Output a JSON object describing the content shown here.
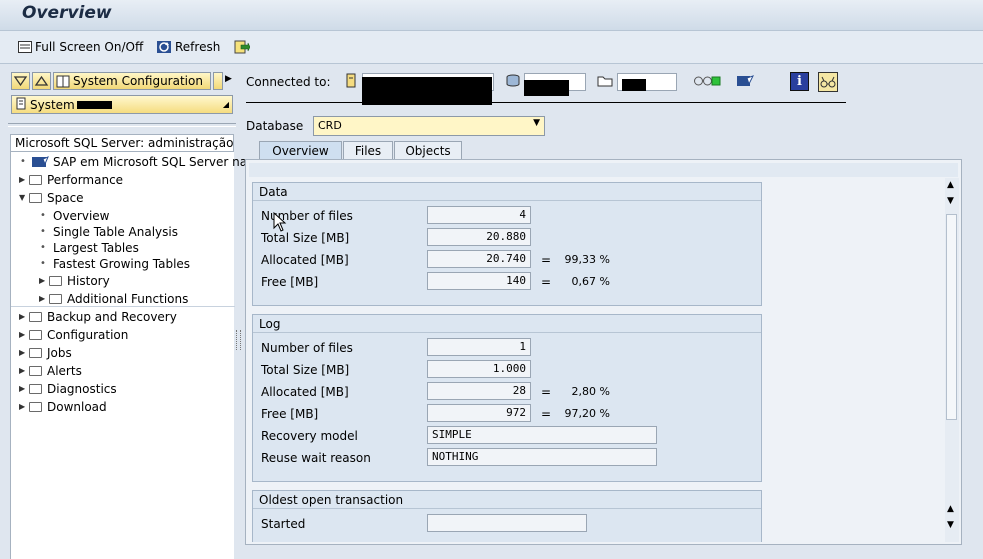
{
  "window": {
    "title": "Overview"
  },
  "toolbar": {
    "fullscreen_label": "Full Screen On/Off",
    "refresh_label": "Refresh"
  },
  "nav": {
    "system_config_label": "System Configuration",
    "system_label": "System"
  },
  "tree": {
    "header": "Microsoft SQL Server: administração...",
    "items": [
      {
        "label": "SAP em Microsoft SQL Server na"
      },
      {
        "label": "Performance"
      },
      {
        "label": "Space"
      },
      {
        "label": "Overview"
      },
      {
        "label": "Single Table Analysis"
      },
      {
        "label": "Largest Tables"
      },
      {
        "label": "Fastest Growing Tables"
      },
      {
        "label": "History"
      },
      {
        "label": "Additional Functions"
      },
      {
        "label": "Backup and Recovery"
      },
      {
        "label": "Configuration"
      },
      {
        "label": "Jobs"
      },
      {
        "label": "Alerts"
      },
      {
        "label": "Diagnostics"
      },
      {
        "label": "Download"
      }
    ]
  },
  "header": {
    "connected_label": "Connected to:",
    "database_label": "Database",
    "database_value": "CRD"
  },
  "tabs": [
    {
      "label": "Overview"
    },
    {
      "label": "Files"
    },
    {
      "label": "Objects"
    }
  ],
  "data_group": {
    "title": "Data",
    "rows": [
      {
        "label": "Number of files",
        "value": "4"
      },
      {
        "label": "Total Size [MB]",
        "value": "20.880"
      },
      {
        "label": "Allocated [MB]",
        "value": "20.740",
        "eq": "=",
        "pct": "99,33 %"
      },
      {
        "label": "Free [MB]",
        "value": "140",
        "eq": "=",
        "pct": "0,67 %"
      }
    ]
  },
  "log_group": {
    "title": "Log",
    "rows": [
      {
        "label": "Number of files",
        "value": "1"
      },
      {
        "label": "Total Size [MB]",
        "value": "1.000"
      },
      {
        "label": "Allocated [MB]",
        "value": "28",
        "eq": "=",
        "pct": "2,80 %"
      },
      {
        "label": "Free [MB]",
        "value": "972",
        "eq": "=",
        "pct": "97,20 %"
      },
      {
        "label": "Recovery model",
        "value": "SIMPLE"
      },
      {
        "label": "Reuse wait reason",
        "value": "NOTHING"
      }
    ]
  },
  "oldest_group": {
    "title": "Oldest open transaction",
    "rows": [
      {
        "label": "Started",
        "value": ""
      }
    ]
  }
}
